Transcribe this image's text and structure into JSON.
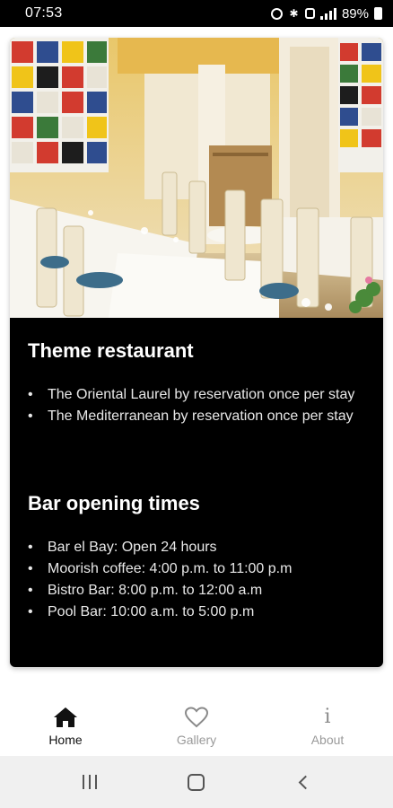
{
  "status_bar": {
    "time": "07:53",
    "battery": "89%"
  },
  "hero_image": {
    "alt": "restaurant-dining-room-photo"
  },
  "sections": [
    {
      "title": "Theme restaurant",
      "items": [
        "The Oriental Laurel by reservation once per stay",
        "The Mediterranean by reservation once per stay"
      ]
    },
    {
      "title": "Bar opening times",
      "items": [
        "Bar el Bay: Open 24 hours",
        "Moorish coffee: 4:00 p.m. to 11:00 p.m",
        "Bistro Bar: 8:00 p.m. to 12:00 a.m",
        "Pool Bar: 10:00 a.m. to 5:00 p.m"
      ]
    }
  ],
  "bottom_nav": {
    "items": [
      {
        "label": "Home",
        "icon": "home-icon",
        "active": true
      },
      {
        "label": "Gallery",
        "icon": "heart-icon",
        "active": false
      },
      {
        "label": "About",
        "icon": "info-icon",
        "active": false
      }
    ]
  },
  "system_nav": {
    "icons": [
      "recents-icon",
      "home-circle-icon",
      "back-icon"
    ]
  },
  "colors": {
    "card_background": "#000000",
    "status_bar": "#000000",
    "nav_active": "#111111",
    "nav_inactive": "#9a9a9a"
  }
}
